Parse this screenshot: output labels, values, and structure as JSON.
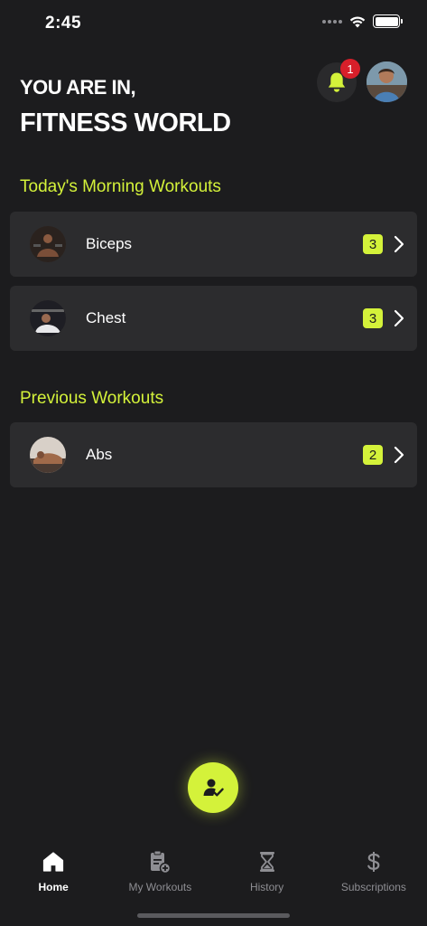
{
  "status_bar": {
    "time": "2:45"
  },
  "header": {
    "greeting": "YOU ARE IN,",
    "app_name": "FITNESS WORLD",
    "notification_count": "1"
  },
  "sections": {
    "morning": {
      "title": "Today's Morning Workouts",
      "items": [
        {
          "name": "Biceps",
          "count": "3"
        },
        {
          "name": "Chest",
          "count": "3"
        }
      ]
    },
    "previous": {
      "title": "Previous Workouts",
      "items": [
        {
          "name": "Abs",
          "count": "2"
        }
      ]
    }
  },
  "tabs": [
    {
      "label": "Home",
      "icon": "home-icon",
      "active": true
    },
    {
      "label": "My Workouts",
      "icon": "clipboard-add-icon",
      "active": false
    },
    {
      "label": "History",
      "icon": "hourglass-icon",
      "active": false
    },
    {
      "label": "Subscriptions",
      "icon": "dollar-icon",
      "active": false
    }
  ],
  "colors": {
    "background": "#1c1c1e",
    "card": "#2c2c2e",
    "accent": "#d4f23a",
    "badge_red": "#d71f2a"
  }
}
